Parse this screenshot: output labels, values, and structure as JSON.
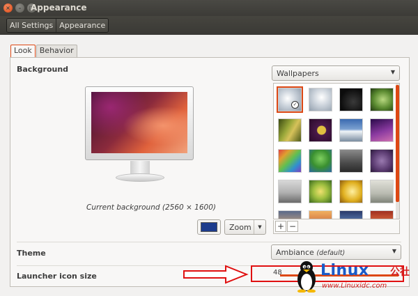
{
  "window": {
    "title": "Appearance",
    "close_glyph": "×",
    "min_glyph": "–",
    "max_glyph": "□"
  },
  "breadcrumb": [
    "All Settings",
    "Appearance"
  ],
  "tabs": [
    {
      "label": "Look",
      "active": true
    },
    {
      "label": "Behavior",
      "active": false
    }
  ],
  "look": {
    "background_label": "Background",
    "current_background": "Current background (2560 × 1600)",
    "wallpaper_source": "Wallpapers",
    "zoom_mode": "Zoom",
    "color_value": "#1c3b8c",
    "add_glyph": "+",
    "remove_glyph": "−",
    "selected_check": "✓",
    "combo_arrow": "▼",
    "wallpapers": [
      {
        "name": "light-gray-flowers-selected",
        "selected": true
      },
      {
        "name": "light-gray-flowers",
        "selected": false
      },
      {
        "name": "dark-abstract",
        "selected": false
      },
      {
        "name": "green-leaf",
        "selected": false
      },
      {
        "name": "golden-grass",
        "selected": false
      },
      {
        "name": "purple-disc",
        "selected": false
      },
      {
        "name": "snowy-mountains",
        "selected": false
      },
      {
        "name": "purple-sky",
        "selected": false
      },
      {
        "name": "rainbow-fabric",
        "selected": false
      },
      {
        "name": "green-tree",
        "selected": false
      },
      {
        "name": "dark-figure",
        "selected": false
      },
      {
        "name": "violet-bird",
        "selected": false
      },
      {
        "name": "gray-sea",
        "selected": false
      },
      {
        "name": "yellow-flower",
        "selected": false
      },
      {
        "name": "yellow-petals",
        "selected": false
      },
      {
        "name": "gray-grass",
        "selected": false
      },
      {
        "name": "dusk-landscape",
        "selected": false
      },
      {
        "name": "sunset-sky",
        "selected": false
      },
      {
        "name": "blue-landscape",
        "selected": false
      },
      {
        "name": "red-warm",
        "selected": false
      }
    ],
    "theme_label": "Theme",
    "theme_value": "Ambiance",
    "theme_default_suffix": "(default)",
    "launcher_label": "Launcher icon size",
    "launcher_value": "48"
  },
  "watermark": {
    "brand": "Linux",
    "cn": "公社",
    "url": "www.Linuxidc.com"
  },
  "colors": {
    "accent": "#dd4814",
    "annotation": "#e01010"
  }
}
